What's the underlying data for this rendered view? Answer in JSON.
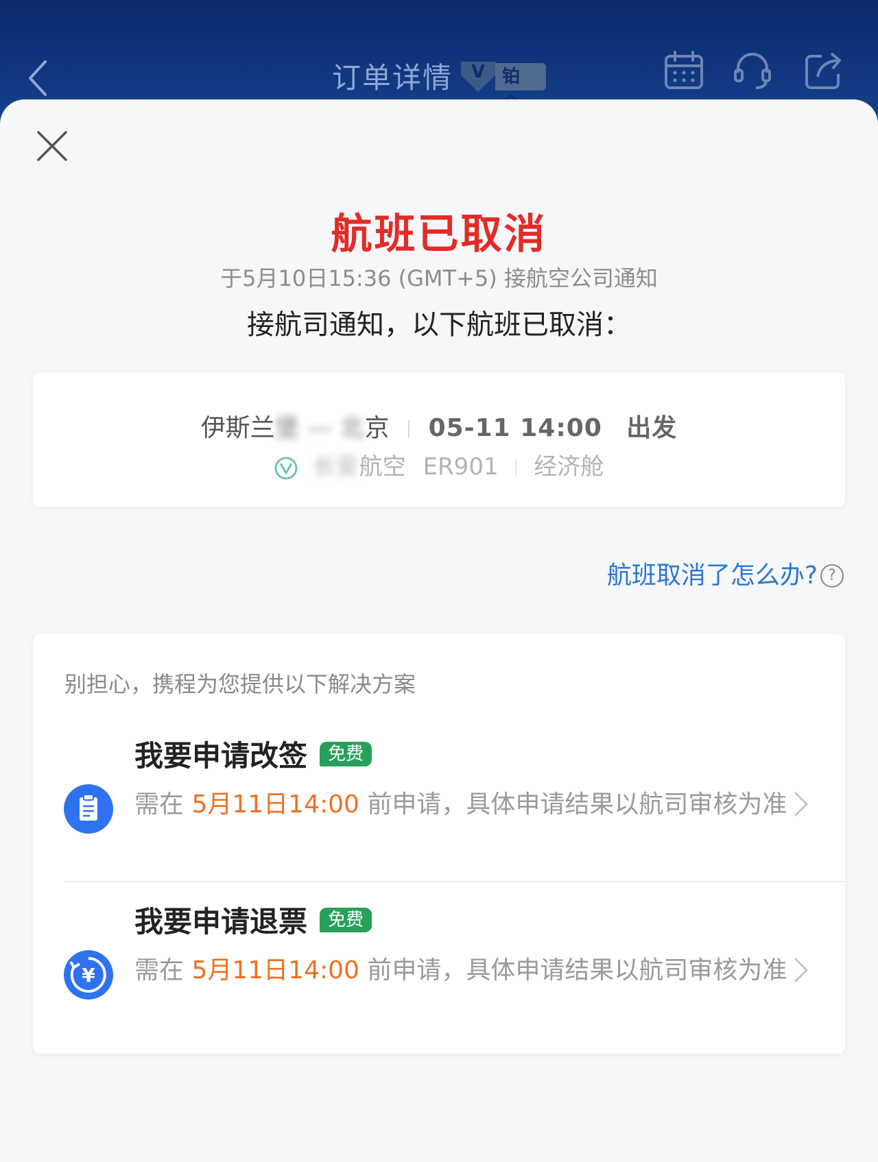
{
  "nav": {
    "title": "订单详情",
    "tier": "铂金",
    "buttons": [
      {
        "label": "日历",
        "icon": "calendar-icon"
      },
      {
        "label": "客服",
        "icon": "headset-icon"
      },
      {
        "label": "分享",
        "icon": "share-icon"
      }
    ]
  },
  "status": {
    "title": "航班已取消",
    "notify_time": "于5月10日15:36 (GMT+5) 接航空公司通知",
    "notify_message": "接航司通知，以下航班已取消："
  },
  "flight": {
    "origin_visible": "伊斯兰",
    "origin_blurred": "堡",
    "dash": "—",
    "destination_blurred": "北",
    "destination_visible": "京",
    "departure": "05-11 14:00",
    "departure_suffix": "出发",
    "airline_blurred": "长安",
    "airline_visible": "航空",
    "flight_no": "ER901",
    "cabin": "经济舱"
  },
  "help_link": "航班取消了怎么办?",
  "solutions": {
    "intro": "别担心，携程为您提供以下解决方案",
    "options": [
      {
        "title": "我要申请改签",
        "badge": "免费",
        "desc_prefix": "需在",
        "deadline": "5月11日14:00",
        "desc_suffix": "前申请，具体申请结果以航司审核为准",
        "icon": "document-icon"
      },
      {
        "title": "我要申请退票",
        "badge": "免费",
        "desc_prefix": "需在",
        "deadline": "5月11日14:00",
        "desc_suffix": "前申请，具体申请结果以航司审核为准",
        "icon": "refund-yuan-icon"
      }
    ]
  },
  "colors": {
    "nav_bg": "#0b2a6c",
    "status_red": "#e32b27",
    "link_blue": "#2b77d6",
    "deadline_orange": "#f07020",
    "badge_green": "#27a05a",
    "icon_blue": "#2e72f0"
  }
}
